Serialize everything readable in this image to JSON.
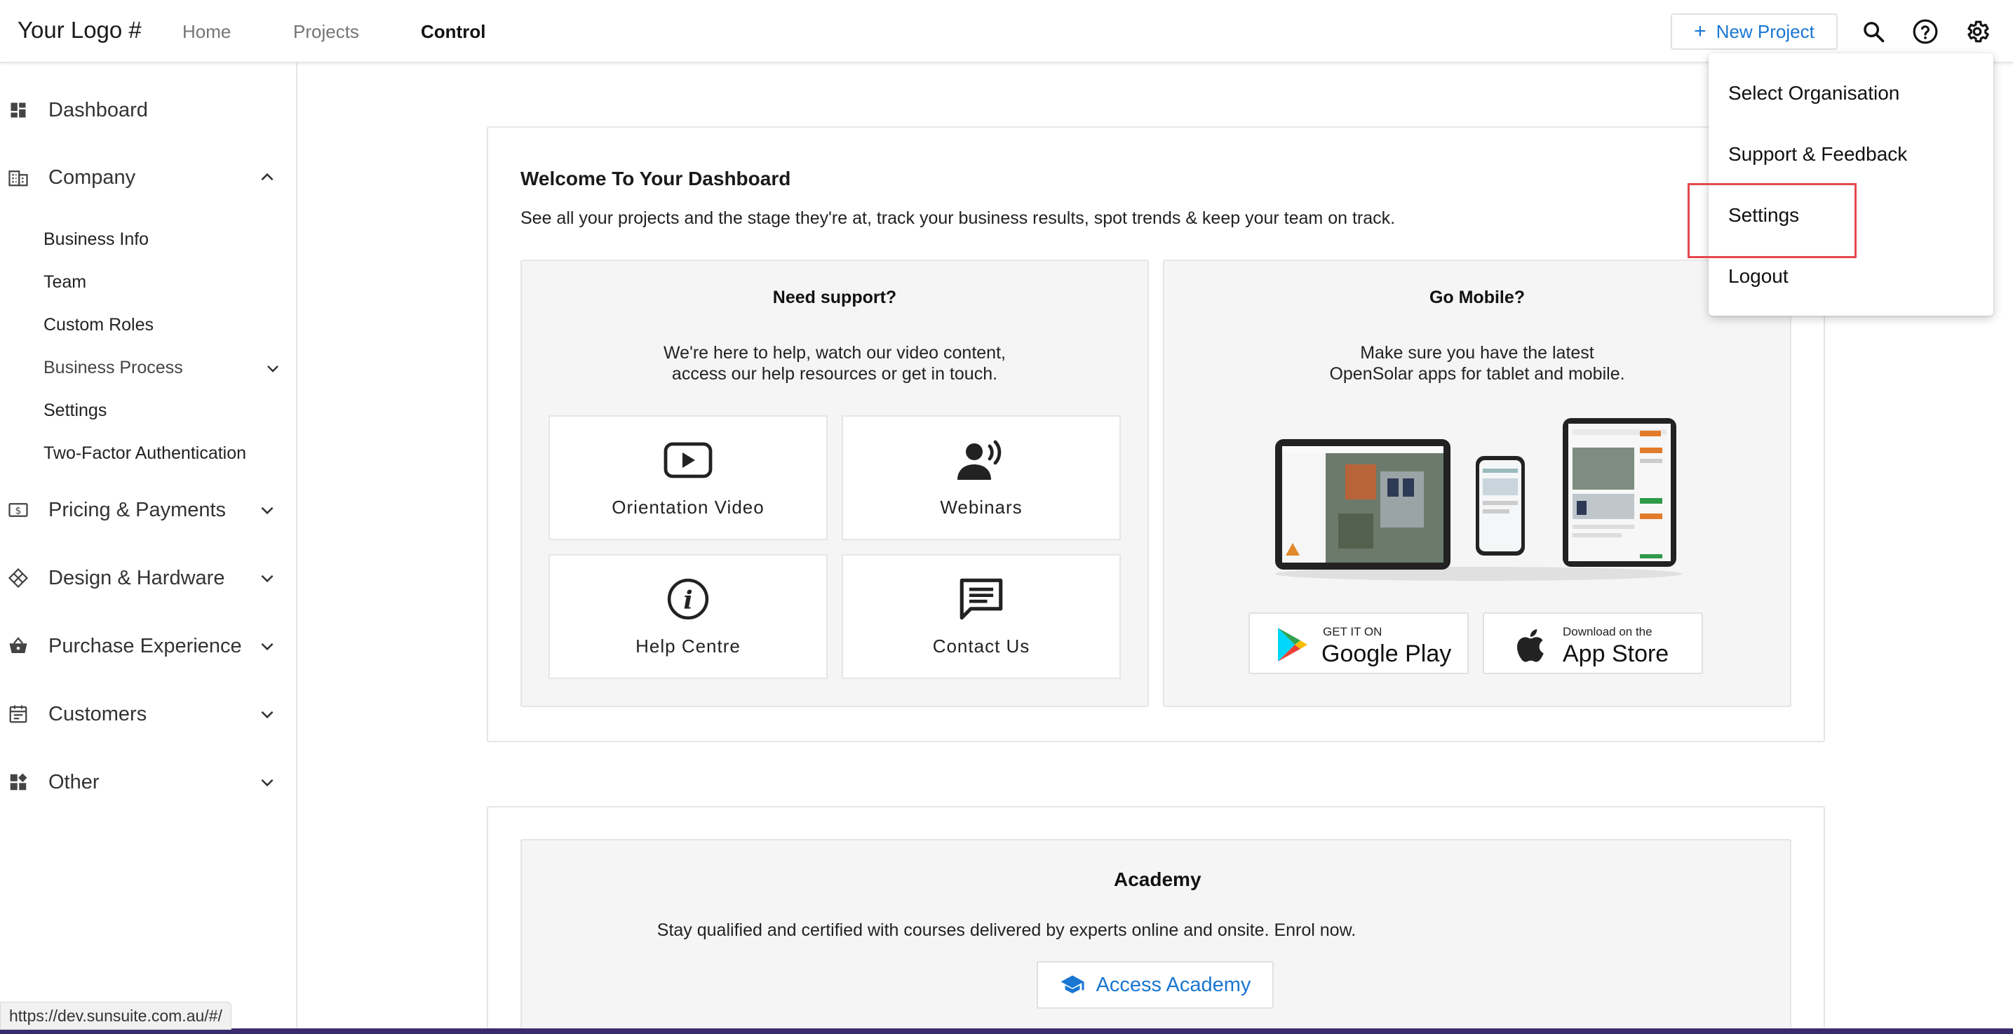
{
  "header": {
    "logo": "Your Logo #",
    "nav": [
      "Home",
      "Projects",
      "Control"
    ],
    "active_nav": "Control",
    "new_project_label": "New Project"
  },
  "sidebar": {
    "dashboard": "Dashboard",
    "company": "Company",
    "company_sub": [
      "Business Info",
      "Team",
      "Custom Roles",
      "Business Process",
      "Settings",
      "Two-Factor Authentication"
    ],
    "sections": [
      "Pricing & Payments",
      "Design & Hardware",
      "Purchase Experience",
      "Customers",
      "Other"
    ]
  },
  "welcome": {
    "title": "Welcome To Your Dashboard",
    "subtitle": "See all your projects and the stage they're at, track your business results, spot trends & keep your team on track."
  },
  "support": {
    "title": "Need support?",
    "text_line1": "We're here to help, watch our video content,",
    "text_line2": "access our help resources or get in touch.",
    "tiles": [
      "Orientation Video",
      "Webinars",
      "Help Centre",
      "Contact Us"
    ]
  },
  "mobile": {
    "title": "Go Mobile?",
    "text_line1": "Make sure you have the latest",
    "text_line2": "OpenSolar apps for tablet and mobile.",
    "google_small": "GET IT ON",
    "google_big": "Google Play",
    "apple_small": "Download on the",
    "apple_big": "App Store"
  },
  "academy": {
    "title": "Academy",
    "text": "Stay qualified and certified with courses delivered by experts online and onsite. Enrol now.",
    "button": "Access Academy"
  },
  "settings_menu": {
    "items": [
      "Select Organisation",
      "Support & Feedback",
      "Settings",
      "Logout"
    ],
    "highlighted": "Settings"
  },
  "status_url": "https://dev.sunsuite.com.au/#/",
  "colors": {
    "accent": "#1976d2",
    "highlight_box": "#e5484d",
    "panel_bg": "#f5f5f5"
  }
}
